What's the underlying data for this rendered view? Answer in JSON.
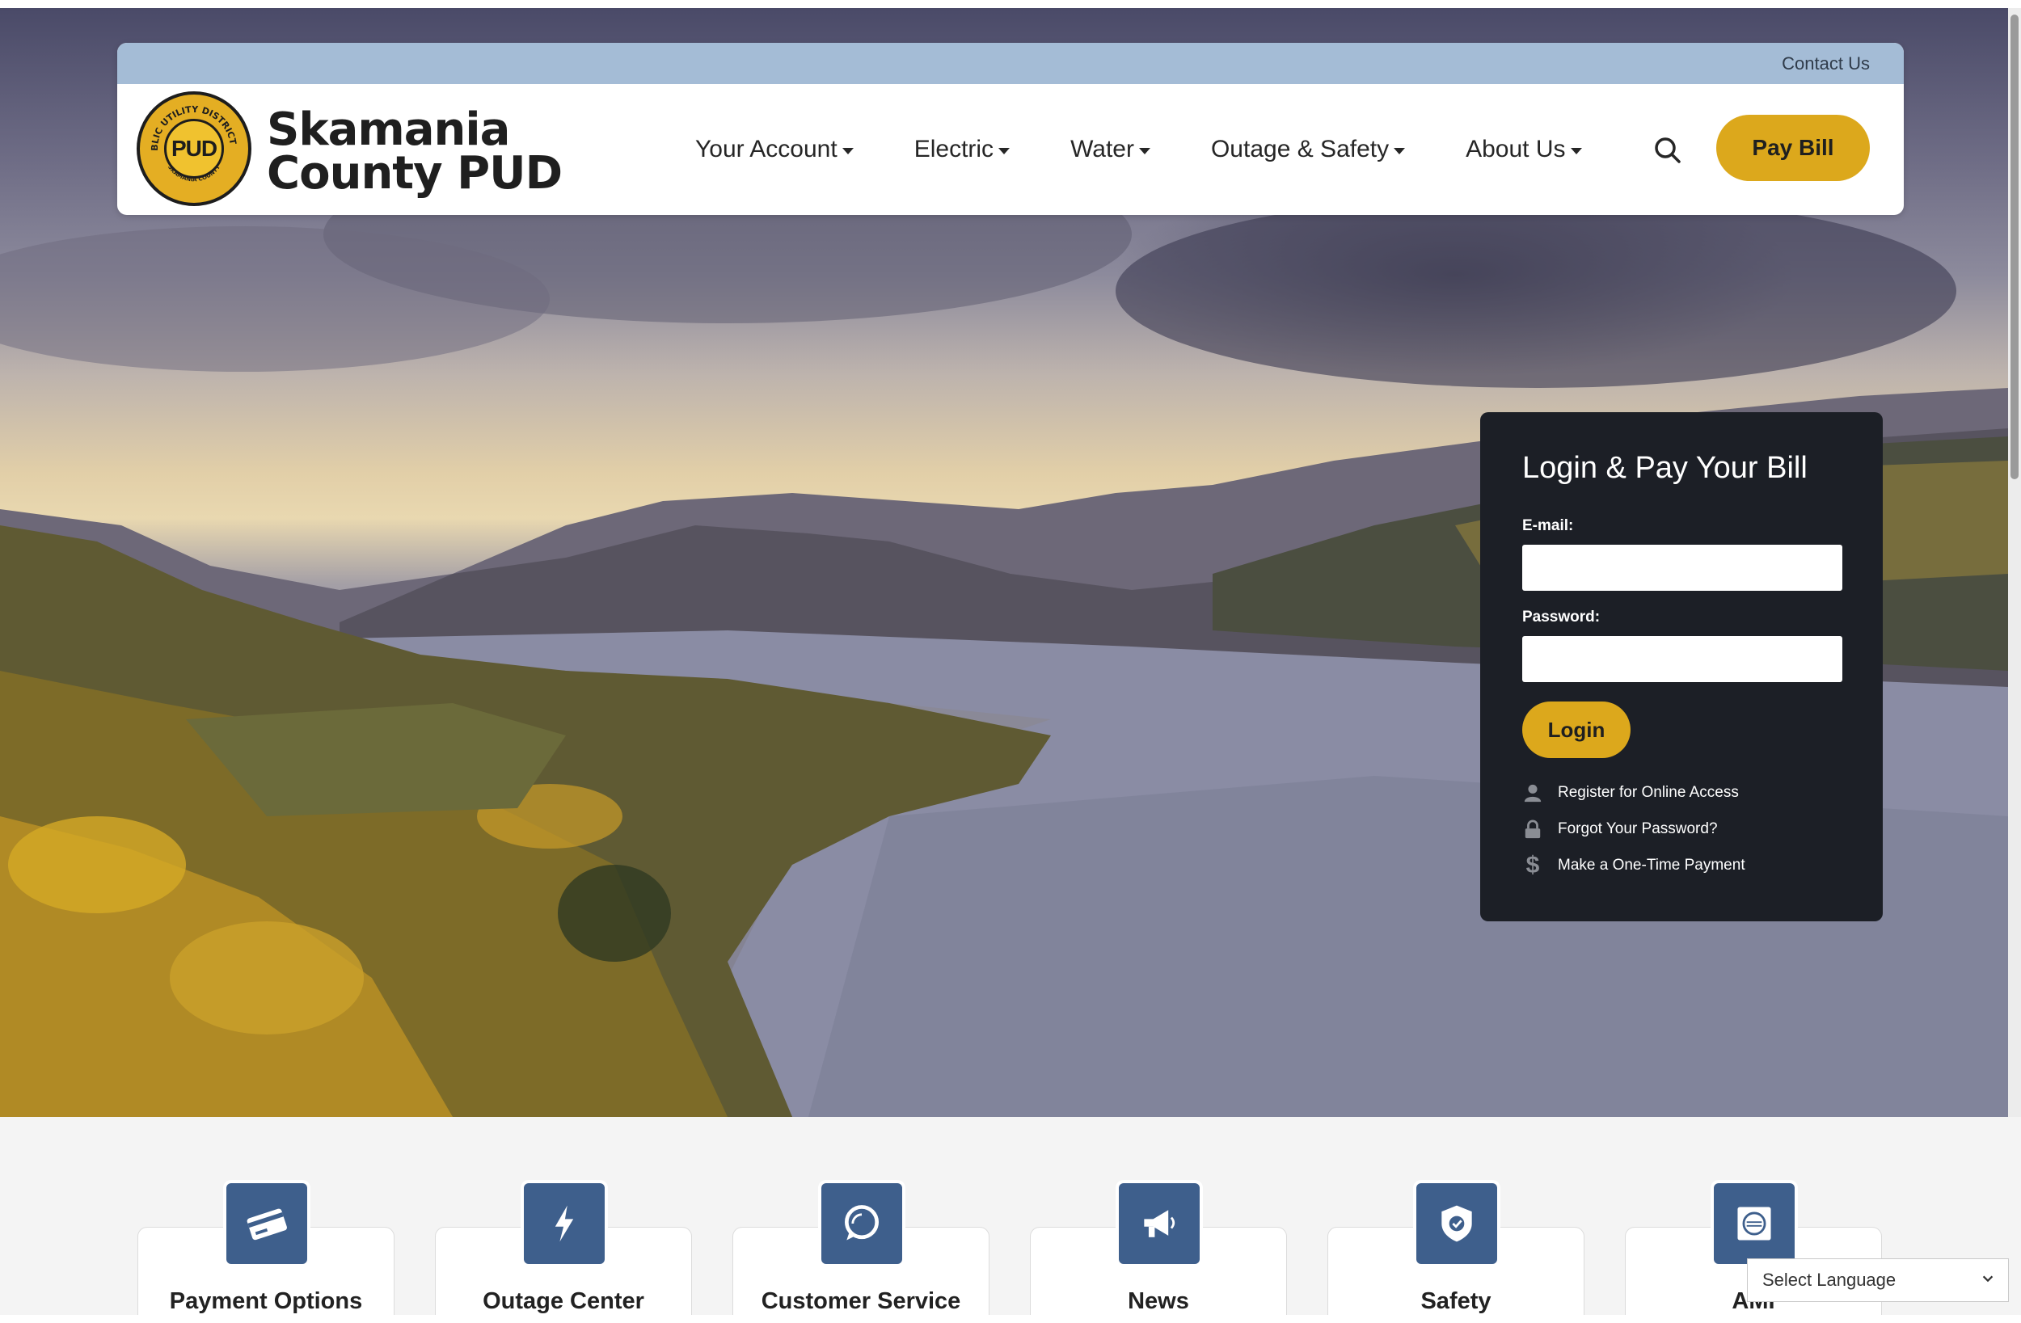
{
  "header": {
    "contact_link": "Contact Us",
    "logo_seal_text": "PUD",
    "logo_ring_top": "PUBLIC UTILITY DISTRICT # 1",
    "logo_ring_bottom": "SKAMANIA COUNTY",
    "logo_line1": "Skamania",
    "logo_line2": "County PUD",
    "nav": [
      {
        "label": "Your Account"
      },
      {
        "label": "Electric"
      },
      {
        "label": "Water"
      },
      {
        "label": "Outage & Safety"
      },
      {
        "label": "About Us"
      }
    ],
    "pay_bill_label": "Pay Bill"
  },
  "login": {
    "title": "Login & Pay Your Bill",
    "email_label": "E-mail:",
    "email_value": "",
    "password_label": "Password:",
    "password_value": "",
    "login_button": "Login",
    "links": [
      {
        "label": "Register for Online Access",
        "icon": "user-icon"
      },
      {
        "label": "Forgot Your Password?",
        "icon": "lock-icon"
      },
      {
        "label": "Make a One-Time Payment",
        "icon": "dollar-icon"
      }
    ]
  },
  "tiles": [
    {
      "label": "Payment Options",
      "icon": "credit-card-icon"
    },
    {
      "label": "Outage Center",
      "icon": "lightning-icon"
    },
    {
      "label": "Customer Service",
      "icon": "chat-bubble-icon"
    },
    {
      "label": "News",
      "icon": "megaphone-icon"
    },
    {
      "label": "Safety",
      "icon": "shield-icon"
    },
    {
      "label": "AMI",
      "icon": "meter-icon"
    }
  ],
  "language": {
    "selected": "Select Language"
  },
  "colors": {
    "accent_gold": "#dca81c",
    "topbar_blue": "#a4bcd6",
    "tile_blue": "#3e5f8c",
    "login_bg": "#1c1f26"
  }
}
